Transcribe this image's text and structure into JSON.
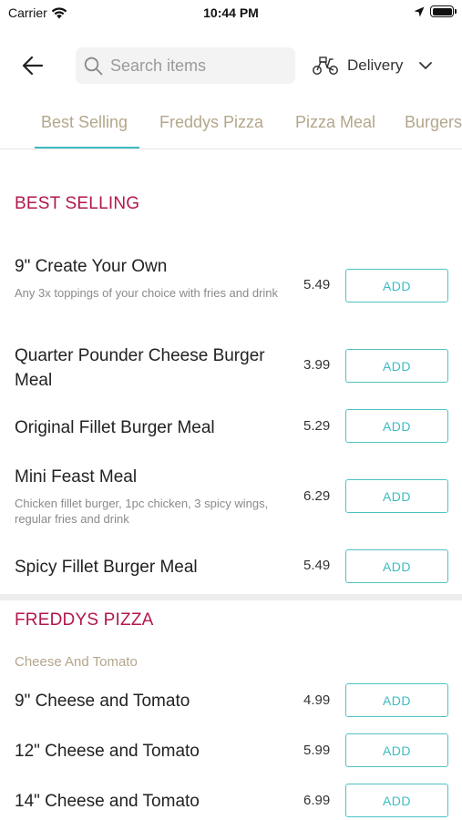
{
  "status_bar": {
    "carrier": "Carrier",
    "time": "10:44 PM"
  },
  "header": {
    "search_placeholder": "Search items",
    "delivery_label": "Delivery"
  },
  "tabs": [
    {
      "label": "Best Selling",
      "active": true
    },
    {
      "label": "Freddys Pizza",
      "active": false
    },
    {
      "label": "Pizza Meal",
      "active": false
    },
    {
      "label": "Burgers",
      "active": false
    }
  ],
  "sections": [
    {
      "title": "BEST SELLING",
      "items": [
        {
          "name": "9\" Create Your Own",
          "desc": "Any 3x toppings of your choice with fries and drink",
          "price": "5.49",
          "button": "ADD"
        },
        {
          "name": "Quarter Pounder Cheese Burger Meal",
          "price": "3.99",
          "button": "ADD"
        },
        {
          "name": "Original Fillet Burger Meal",
          "price": "5.29",
          "button": "ADD"
        },
        {
          "name": "Mini Feast Meal",
          "desc": "Chicken fillet burger, 1pc chicken, 3 spicy wings, regular fries and drink",
          "price": "6.29",
          "button": "ADD"
        },
        {
          "name": "Spicy Fillet Burger Meal",
          "price": "5.49",
          "button": "ADD"
        }
      ]
    },
    {
      "title": "FREDDYS PIZZA",
      "subsection": "Cheese And Tomato",
      "items": [
        {
          "name": "9\" Cheese and Tomato",
          "price": "4.99",
          "button": "ADD"
        },
        {
          "name": "12\" Cheese and Tomato",
          "price": "5.99",
          "button": "ADD"
        },
        {
          "name": "14\" Cheese and Tomato",
          "price": "6.99",
          "button": "ADD"
        }
      ]
    }
  ],
  "colors": {
    "section_title": "#b3174b",
    "tab_text": "#b4a68b",
    "accent": "#3cbcc0"
  }
}
